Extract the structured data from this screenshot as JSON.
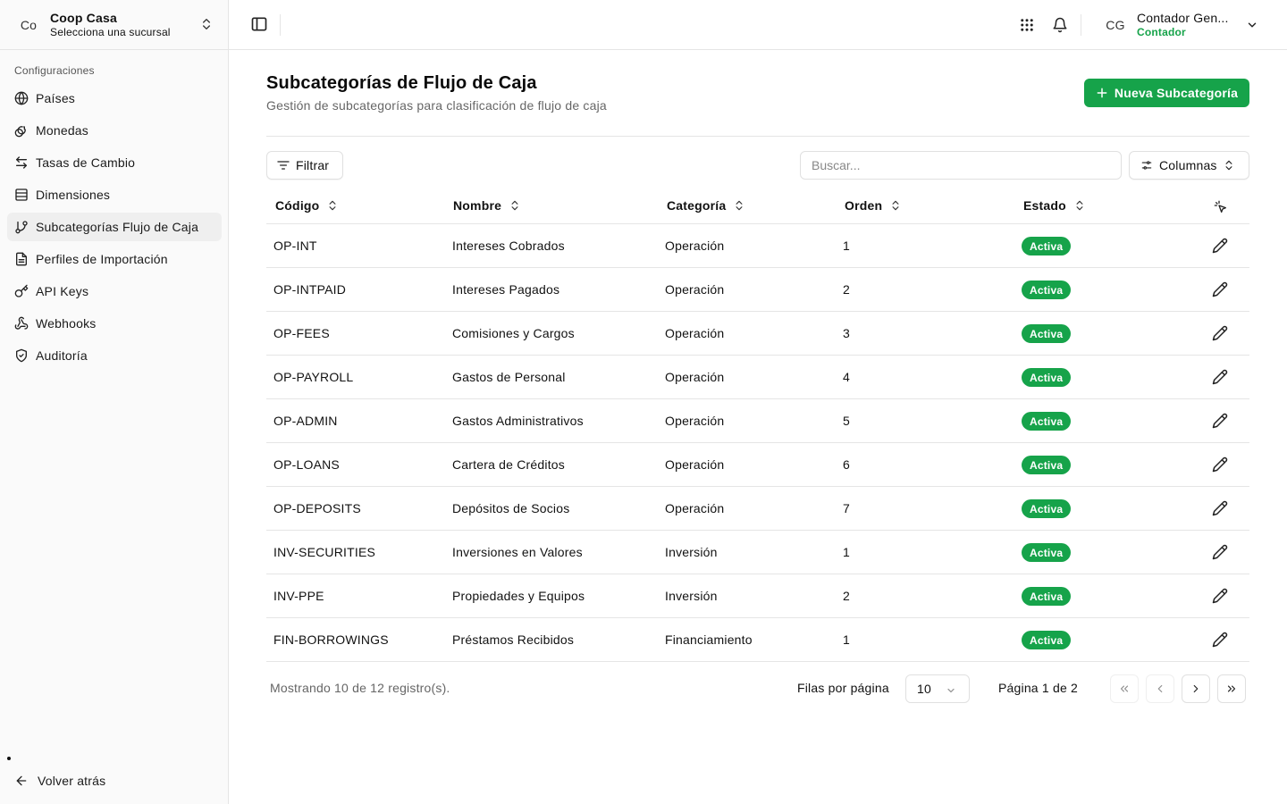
{
  "org": {
    "initials": "Co",
    "name": "Coop Casa",
    "subtitle": "Selecciona una sucursal"
  },
  "sidebar": {
    "section_label": "Configuraciones",
    "items": [
      {
        "label": "Países",
        "icon": "globe-icon"
      },
      {
        "label": "Monedas",
        "icon": "coins-icon"
      },
      {
        "label": "Tasas de Cambio",
        "icon": "arrows-exchange-icon"
      },
      {
        "label": "Dimensiones",
        "icon": "list-icon"
      },
      {
        "label": "Subcategorías Flujo de Caja",
        "icon": "git-branch-icon",
        "active": true
      },
      {
        "label": "Perfiles de Importación",
        "icon": "file-icon"
      },
      {
        "label": "API Keys",
        "icon": "key-icon"
      },
      {
        "label": "Webhooks",
        "icon": "webhook-icon"
      },
      {
        "label": "Auditoría",
        "icon": "shield-check-icon"
      }
    ],
    "back_label": "Volver atrás"
  },
  "user": {
    "initials": "CG",
    "name": "Contador Gen...",
    "role": "Contador"
  },
  "page": {
    "title": "Subcategorías de Flujo de Caja",
    "subtitle": "Gestión de subcategorías para clasificación de flujo de caja",
    "new_button": "Nueva Subcategoría"
  },
  "toolbar": {
    "filter_label": "Filtrar",
    "search_placeholder": "Buscar...",
    "columns_label": "Columnas"
  },
  "table": {
    "columns": [
      "Código",
      "Nombre",
      "Categoría",
      "Orden",
      "Estado"
    ],
    "rows": [
      {
        "code": "OP-INT",
        "name": "Intereses Cobrados",
        "category": "Operación",
        "order": "1",
        "status": "Activa"
      },
      {
        "code": "OP-INTPAID",
        "name": "Intereses Pagados",
        "category": "Operación",
        "order": "2",
        "status": "Activa"
      },
      {
        "code": "OP-FEES",
        "name": "Comisiones y Cargos",
        "category": "Operación",
        "order": "3",
        "status": "Activa"
      },
      {
        "code": "OP-PAYROLL",
        "name": "Gastos de Personal",
        "category": "Operación",
        "order": "4",
        "status": "Activa"
      },
      {
        "code": "OP-ADMIN",
        "name": "Gastos Administrativos",
        "category": "Operación",
        "order": "5",
        "status": "Activa"
      },
      {
        "code": "OP-LOANS",
        "name": "Cartera de Créditos",
        "category": "Operación",
        "order": "6",
        "status": "Activa"
      },
      {
        "code": "OP-DEPOSITS",
        "name": "Depósitos de Socios",
        "category": "Operación",
        "order": "7",
        "status": "Activa"
      },
      {
        "code": "INV-SECURITIES",
        "name": "Inversiones en Valores",
        "category": "Inversión",
        "order": "1",
        "status": "Activa"
      },
      {
        "code": "INV-PPE",
        "name": "Propiedades y Equipos",
        "category": "Inversión",
        "order": "2",
        "status": "Activa"
      },
      {
        "code": "FIN-BORROWINGS",
        "name": "Préstamos Recibidos",
        "category": "Financiamiento",
        "order": "1",
        "status": "Activa"
      }
    ]
  },
  "pagination": {
    "showing": "Mostrando 10 de 12 registro(s).",
    "rows_per_page_label": "Filas por página",
    "rows_per_page": "10",
    "page_info": "Página 1 de 2"
  },
  "colors": {
    "accent": "#16a34a",
    "border": "#e5e5e5",
    "sidebar_bg": "#fafafa"
  }
}
